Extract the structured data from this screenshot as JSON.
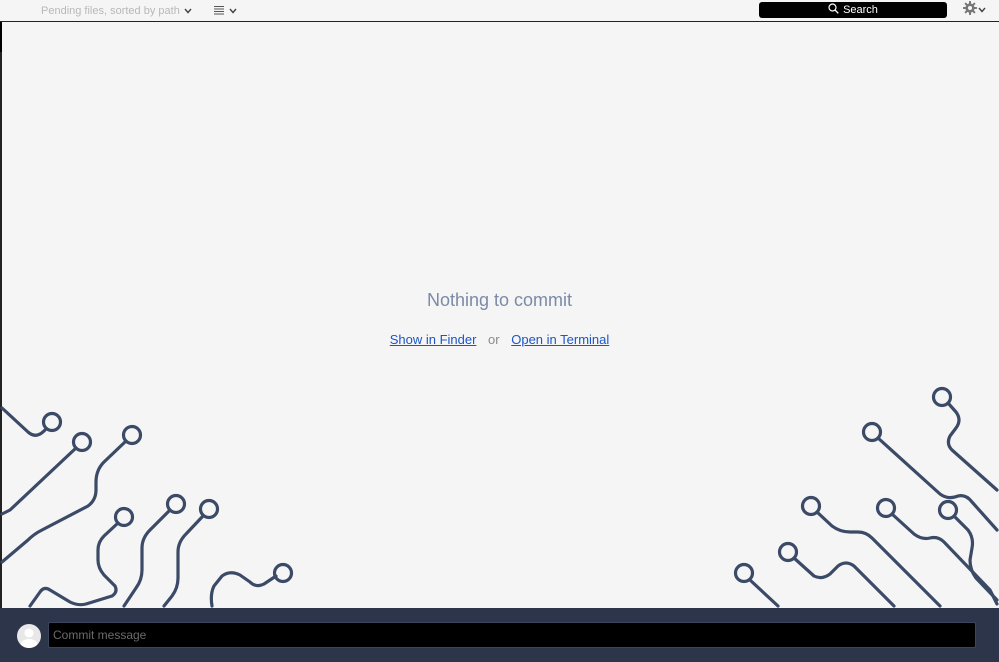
{
  "toolbar": {
    "sort_label": "Pending files, sorted by path",
    "view_icon": "list-lines-icon",
    "search_label": "Search",
    "gear_icon": "gear-icon"
  },
  "empty_state": {
    "title": "Nothing to commit",
    "show_in_finder": "Show in Finder",
    "or": "or",
    "open_in_terminal": "Open in Terminal"
  },
  "commit": {
    "placeholder": "Commit message",
    "value": ""
  },
  "colors": {
    "background": "#f5f5f5",
    "circuit": "#3b4a66",
    "commit_bar": "#2c3549",
    "link": "#1a56c8",
    "title": "#7b8aa6"
  }
}
